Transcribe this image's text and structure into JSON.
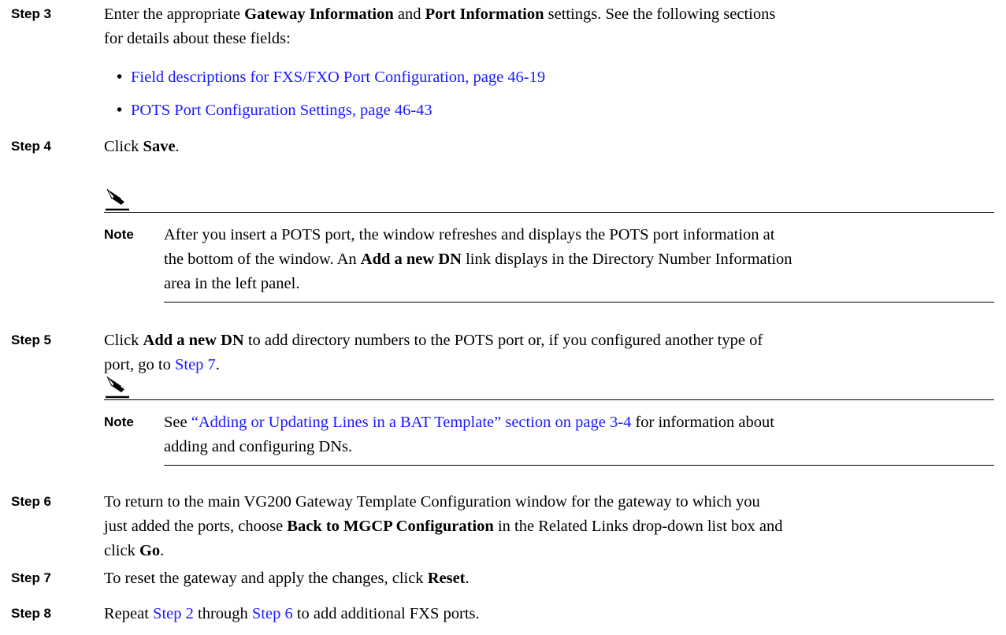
{
  "step3": {
    "label": "Step 3",
    "t1": "Enter the appropriate ",
    "b1": "Gateway Information",
    "t2": " and ",
    "b2": "Port Information",
    "t3": " settings. See the following sections",
    "line2": "for details about these fields:",
    "bullets": [
      "Field descriptions for FXS/FXO Port Configuration, page 46-19",
      "POTS Port Configuration Settings, page 46-43"
    ]
  },
  "step4": {
    "label": "Step 4",
    "t1": "Click ",
    "b1": "Save",
    "t2": "."
  },
  "note1": {
    "label": "Note",
    "l1": "After you insert a POTS port, the window refreshes and displays the POTS port information at",
    "l2a": "the bottom of the window. An ",
    "l2b": "Add a new DN",
    "l2c": " link displays in the Directory Number Information",
    "l3": "area in the left panel."
  },
  "step5": {
    "label": "Step 5",
    "t1": "Click ",
    "b1": "Add a new DN",
    "t2": " to add directory numbers to the POTS port or, if you configured another type of",
    "l2a": "port, go to ",
    "l2link": "Step 7",
    "l2b": "."
  },
  "note2": {
    "label": "Note",
    "t1": "See ",
    "link": "“Adding or Updating Lines in a BAT Template” section on page 3-4",
    "t2": " for information about",
    "l2": "adding and configuring DNs."
  },
  "step6": {
    "label": "Step 6",
    "l1": "To return to the main VG200 Gateway Template Configuration window for the gateway to which you",
    "l2a": "just added the ports, choose ",
    "l2b": "Back to MGCP Configuration",
    "l2c": " in the Related Links drop-down list box and",
    "l3a": "click ",
    "l3b": "Go",
    "l3c": "."
  },
  "step7": {
    "label": "Step 7",
    "t1": "To reset the gateway and apply the changes, click ",
    "b1": "Reset",
    "t2": "."
  },
  "step8": {
    "label": "Step 8",
    "t1": "Repeat ",
    "link1": "Step 2",
    "t2": " through ",
    "link2": "Step 6",
    "t3": " to add additional FXS ports."
  },
  "icons": {
    "note": "pencil-note-icon"
  },
  "colors": {
    "link": "#1a1aff"
  }
}
